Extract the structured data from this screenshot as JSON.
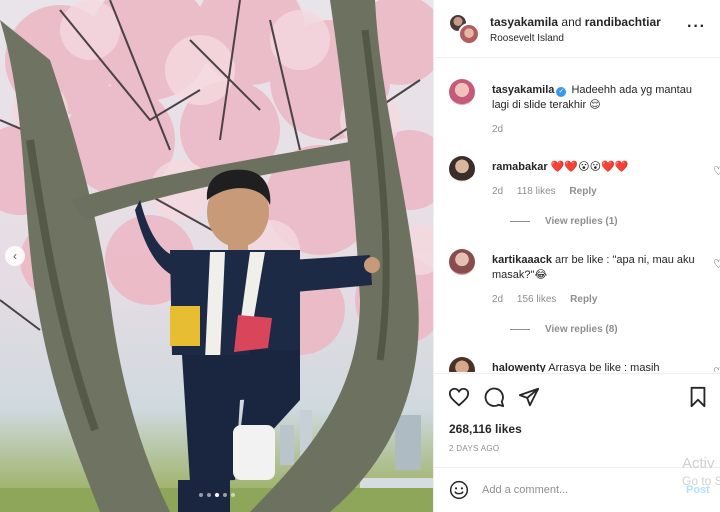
{
  "post": {
    "accounts": {
      "first": "tasyakamila",
      "joiner": " and ",
      "second": "randibachtiar"
    },
    "location": "Roosevelt Island",
    "more_icon": "more-horizontal-icon",
    "carousel": {
      "slide_count": 5,
      "active_index": 2
    }
  },
  "caption": {
    "username": "tasyakamila",
    "verified": true,
    "text": "Hadeehh ada yg mantau lagi di slide terakhir 😌",
    "time": "2d"
  },
  "comments": [
    {
      "username": "ramabakar",
      "text": "❤️❤️😮😮❤️❤️",
      "time": "2d",
      "likes": "118 likes",
      "reply": "Reply",
      "view_replies": "View replies (1)"
    },
    {
      "username": "kartikaaack",
      "text": "arr be like : \"apa ni, mau aku masak?\"😂",
      "time": "2d",
      "likes": "156 likes",
      "reply": "Reply",
      "view_replies": "View replies (8)"
    },
    {
      "username": "halowenty",
      "text": "Arrasya be like : masih"
    }
  ],
  "actions": {
    "likes": "268,116 likes",
    "date": "2 DAYS AGO",
    "icons": [
      "heart-icon",
      "comment-icon",
      "share-icon",
      "bookmark-icon"
    ]
  },
  "add_comment": {
    "placeholder": "Add a comment...",
    "post_label": "Post"
  },
  "watermark": {
    "line1": "Activ",
    "line2": "Go to S"
  },
  "colors": {
    "verified": "#3897f0",
    "post_disabled": "#b2dffc",
    "muted": "#8e8e8e"
  }
}
